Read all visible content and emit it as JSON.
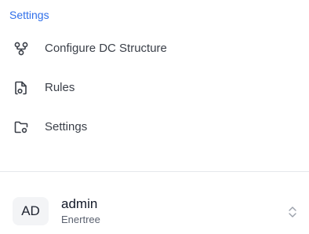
{
  "section": {
    "title": "Settings"
  },
  "menu": {
    "items": [
      {
        "label": "Configure DC Structure",
        "icon": "structure-icon"
      },
      {
        "label": "Rules",
        "icon": "rules-icon"
      },
      {
        "label": "Settings",
        "icon": "folder-settings-icon"
      }
    ]
  },
  "user": {
    "initials": "AD",
    "name": "admin",
    "org": "Enertree"
  },
  "colors": {
    "accent": "#2f6fea",
    "text": "#3a3f48",
    "divider": "#e6e8ec",
    "avatar_bg": "#f3f4f6"
  }
}
